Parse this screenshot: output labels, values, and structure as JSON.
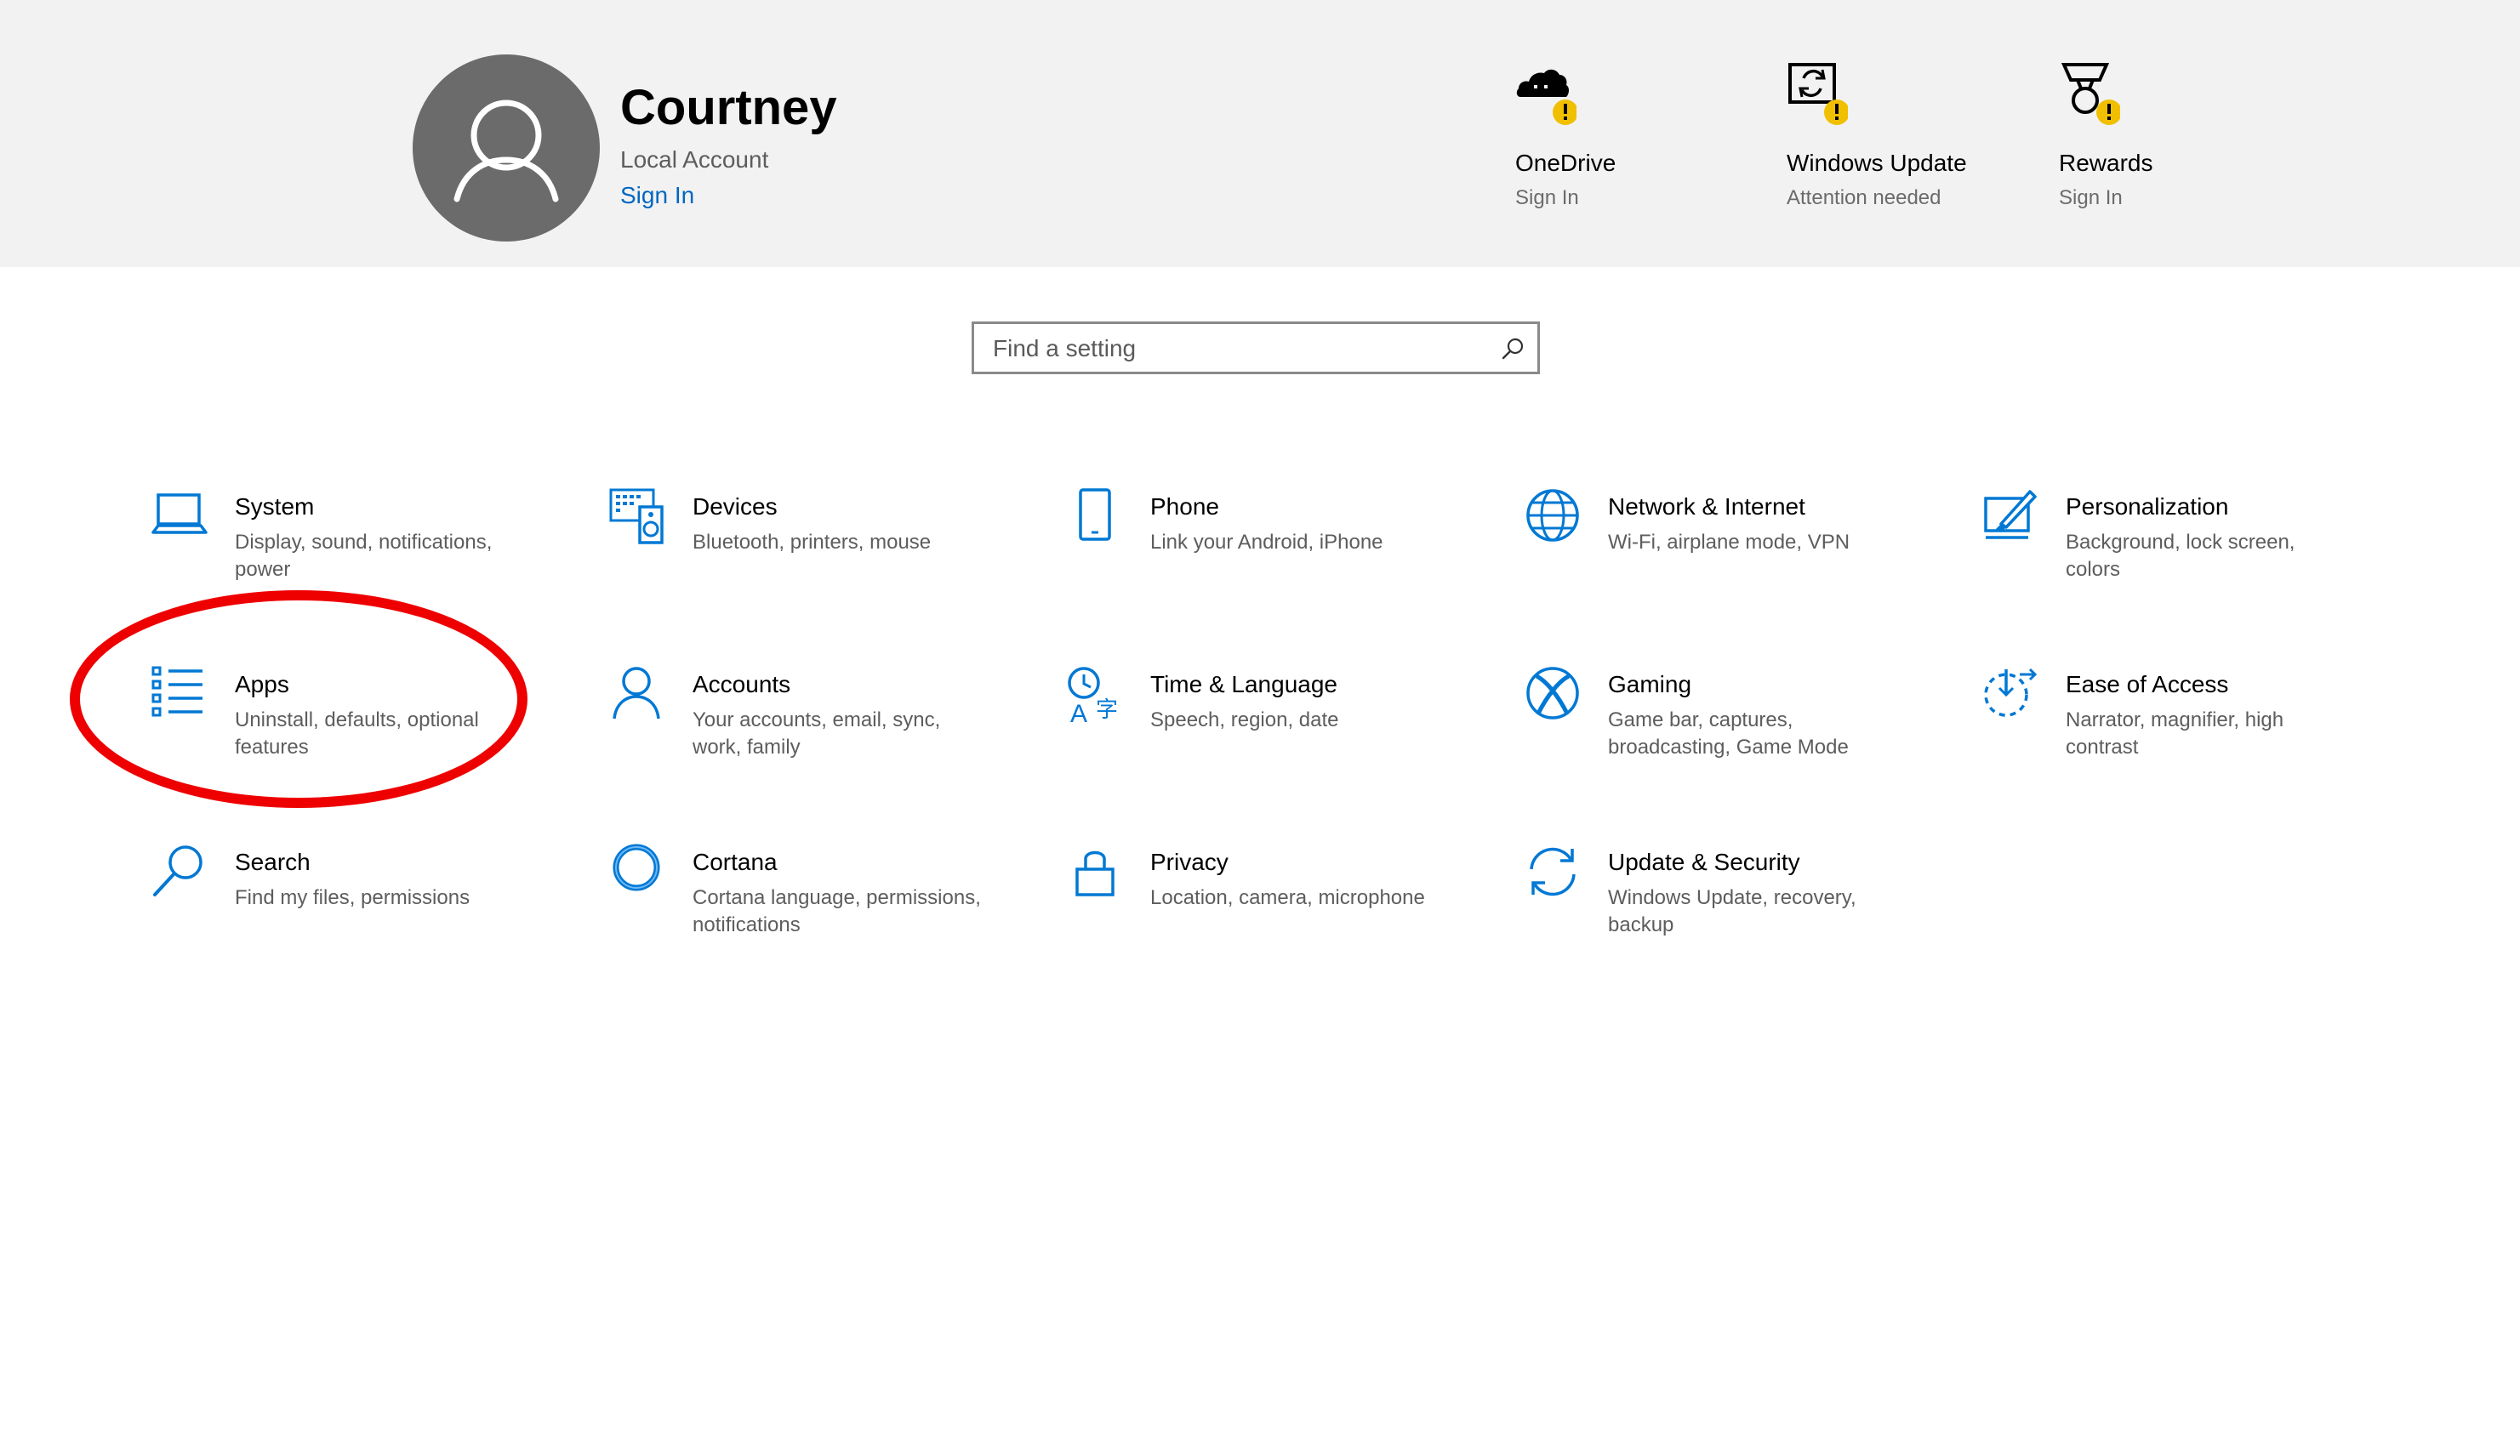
{
  "user": {
    "name": "Courtney",
    "account_type": "Local Account",
    "sign_in_link": "Sign In"
  },
  "status_items": [
    {
      "title": "OneDrive",
      "subtitle": "Sign In",
      "icon": "onedrive-cloud-icon"
    },
    {
      "title": "Windows Update",
      "subtitle": "Attention needed",
      "icon": "windows-update-icon"
    },
    {
      "title": "Rewards",
      "subtitle": "Sign In",
      "icon": "rewards-medal-icon"
    }
  ],
  "search": {
    "placeholder": "Find a setting"
  },
  "tiles": [
    {
      "title": "System",
      "desc": "Display, sound, notifications, power",
      "icon": "laptop-icon"
    },
    {
      "title": "Devices",
      "desc": "Bluetooth, printers, mouse",
      "icon": "devices-icon"
    },
    {
      "title": "Phone",
      "desc": "Link your Android, iPhone",
      "icon": "phone-icon"
    },
    {
      "title": "Network & Internet",
      "desc": "Wi-Fi, airplane mode, VPN",
      "icon": "globe-icon"
    },
    {
      "title": "Personalization",
      "desc": "Background, lock screen, colors",
      "icon": "personalization-icon"
    },
    {
      "title": "Apps",
      "desc": "Uninstall, defaults, optional features",
      "icon": "apps-list-icon"
    },
    {
      "title": "Accounts",
      "desc": "Your accounts, email, sync, work, family",
      "icon": "person-icon"
    },
    {
      "title": "Time & Language",
      "desc": "Speech, region, date",
      "icon": "time-language-icon"
    },
    {
      "title": "Gaming",
      "desc": "Game bar, captures, broadcasting, Game Mode",
      "icon": "xbox-icon"
    },
    {
      "title": "Ease of Access",
      "desc": "Narrator, magnifier, high contrast",
      "icon": "ease-of-access-icon"
    },
    {
      "title": "Search",
      "desc": "Find my files, permissions",
      "icon": "search-magnifier-icon"
    },
    {
      "title": "Cortana",
      "desc": "Cortana language, permissions, notifications",
      "icon": "cortana-ring-icon"
    },
    {
      "title": "Privacy",
      "desc": "Location, camera, microphone",
      "icon": "lock-icon"
    },
    {
      "title": "Update & Security",
      "desc": "Windows Update, recovery, backup",
      "icon": "update-sync-icon"
    }
  ],
  "colors": {
    "accent": "#0067c0",
    "icon_blue": "#0078d4",
    "header_bg": "#f2f2f2",
    "warning_badge": "#f0c000",
    "highlight_ring": "#ee0000"
  }
}
